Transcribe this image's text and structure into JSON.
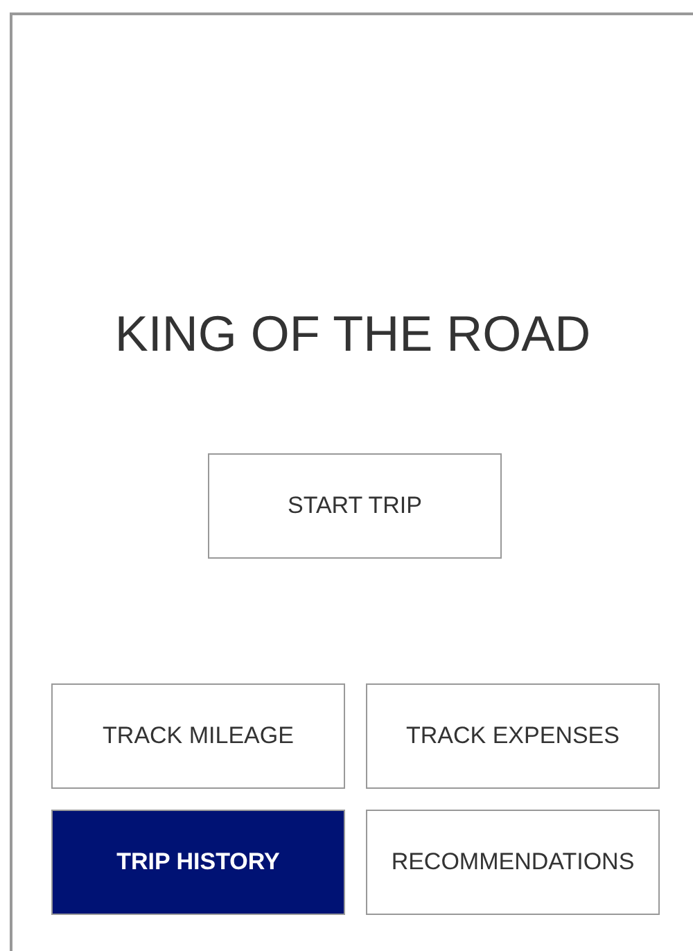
{
  "title": "KING OF THE ROAD",
  "start_button": {
    "label": "START TRIP"
  },
  "menu": [
    {
      "label": "TRACK MILEAGE",
      "selected": false
    },
    {
      "label": "TRACK EXPENSES",
      "selected": false
    },
    {
      "label": "TRIP HISTORY",
      "selected": true
    },
    {
      "label": "RECOMMENDATIONS",
      "selected": false
    }
  ]
}
